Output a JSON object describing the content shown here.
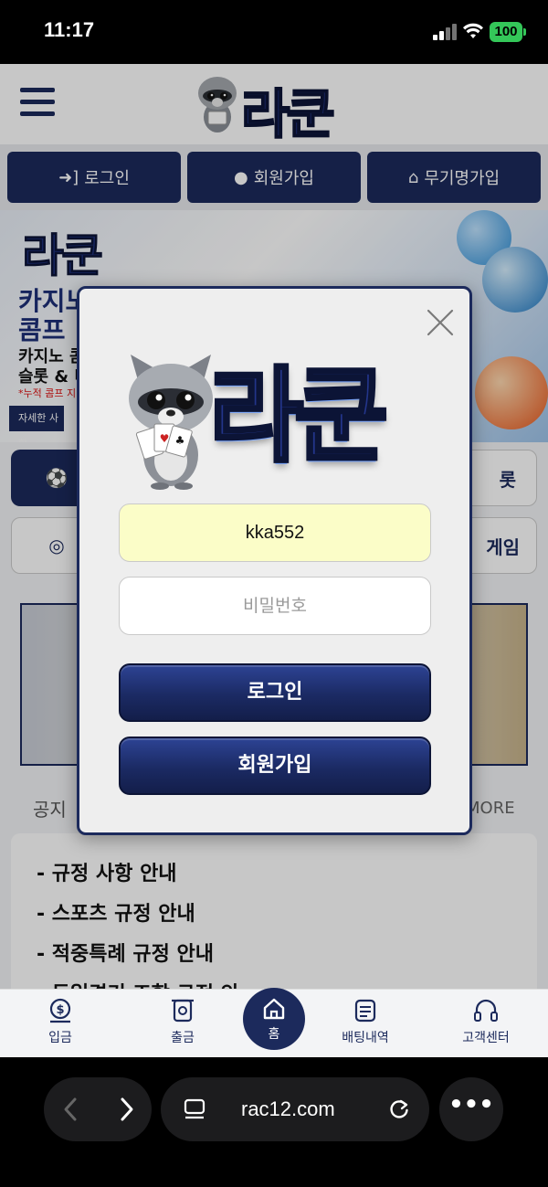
{
  "status_bar": {
    "time": "11:17",
    "battery": "100"
  },
  "header": {
    "logo_text": "라쿤"
  },
  "auth_buttons": [
    {
      "label": "로그인",
      "icon": "login-icon"
    },
    {
      "label": "회원가입",
      "icon": "user-icon"
    },
    {
      "label": "무기명가입",
      "icon": "bank-icon"
    }
  ],
  "banner": {
    "logo_text": "라쿤",
    "headline": "카지노\n콤프",
    "subline": "카지노 콤\n슬롯 & 미",
    "small": "*누적 콤프 지",
    "foot": "자세한 사항"
  },
  "category_labels": [
    "롯",
    "게임"
  ],
  "notices": {
    "title": "공지",
    "more": "MORE",
    "items": [
      "- 규정 사항 안내",
      "- 스포츠 규정 안내",
      "- 적중특례 규정 안내",
      "- 동일경기 조합 규정 안"
    ]
  },
  "bottom_nav": [
    {
      "label": "입금",
      "icon": "deposit-icon"
    },
    {
      "label": "출금",
      "icon": "withdraw-icon"
    },
    {
      "label": "홈",
      "icon": "home-icon"
    },
    {
      "label": "배팅내역",
      "icon": "history-icon"
    },
    {
      "label": "고객센터",
      "icon": "headset-icon"
    }
  ],
  "modal": {
    "logo_text": "라쿤",
    "username_value": "kka552",
    "password_placeholder": "비밀번호",
    "login_label": "로그인",
    "join_label": "회원가입"
  },
  "browser": {
    "url": "rac12.com"
  },
  "colors": {
    "brand_navy": "#1c2a5c",
    "username_fill": "#fbfdc8",
    "battery": "#34c759"
  }
}
